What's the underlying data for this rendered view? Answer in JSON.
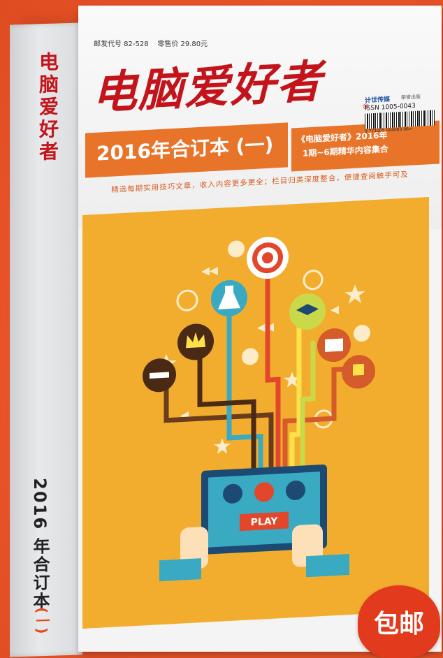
{
  "spine": {
    "logo": "电脑爱好者",
    "year_label": "2016 年合订本",
    "volume": "(一)"
  },
  "cover": {
    "postal_code": "邮发代号 82-528",
    "price": "零售价 29.80元",
    "title": "电脑爱好者",
    "edition": "2016年合订本 (一)",
    "info_line1": "《电脑爱好者》2016年",
    "info_line2": "1期~6期精华内容集合",
    "publisher_logo": "计世传媒",
    "publisher": "荣誉出版",
    "issn": "ISSN 1005-0043",
    "barcode_number": "9 771005 004003  06>",
    "tagline": "精选每期实用技巧文章，收入内容更多更全；栏目归类深度整合，便捷查阅触手可及"
  },
  "illustration": {
    "play_button": "PLAY"
  },
  "badge": {
    "label": "包邮"
  },
  "colors": {
    "background": "#ee5a2c",
    "title_red": "#c3141b",
    "band_orange": "#e8742a",
    "art_yellow": "#f2ad2e",
    "tablet_blue": "#3aa9c2"
  }
}
